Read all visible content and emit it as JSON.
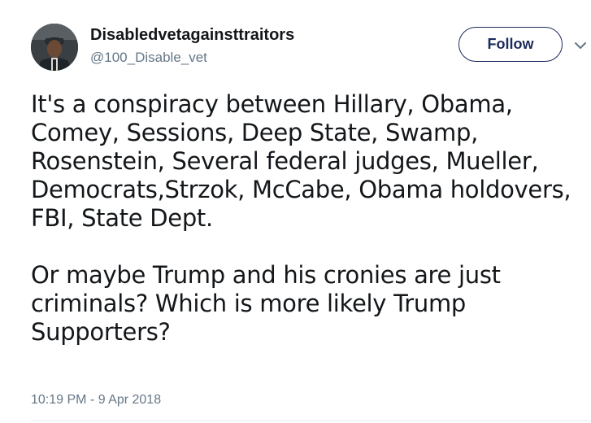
{
  "tweet": {
    "author_name": "Disabledvetagainsttraitors",
    "author_handle": "@100_Disable_vet",
    "follow_label": "Follow",
    "paragraphs": [
      "It's a conspiracy between Hillary, Obama, Comey, Sessions, Deep State, Swamp, Rosenstein, Several federal judges, Mueller, Democrats,Strzok, McCabe, Obama holdovers, FBI, State Dept.",
      "Or maybe Trump and his cronies are just criminals? Which is more likely Trump Supporters?"
    ],
    "timestamp": "10:19 PM - 9 Apr 2018"
  },
  "icons": {
    "menu": "chevron-down-icon"
  },
  "colors": {
    "text": "#14171a",
    "secondary_text": "#657786",
    "follow_border": "#1b2a5c",
    "divider": "#e6ecf0"
  }
}
